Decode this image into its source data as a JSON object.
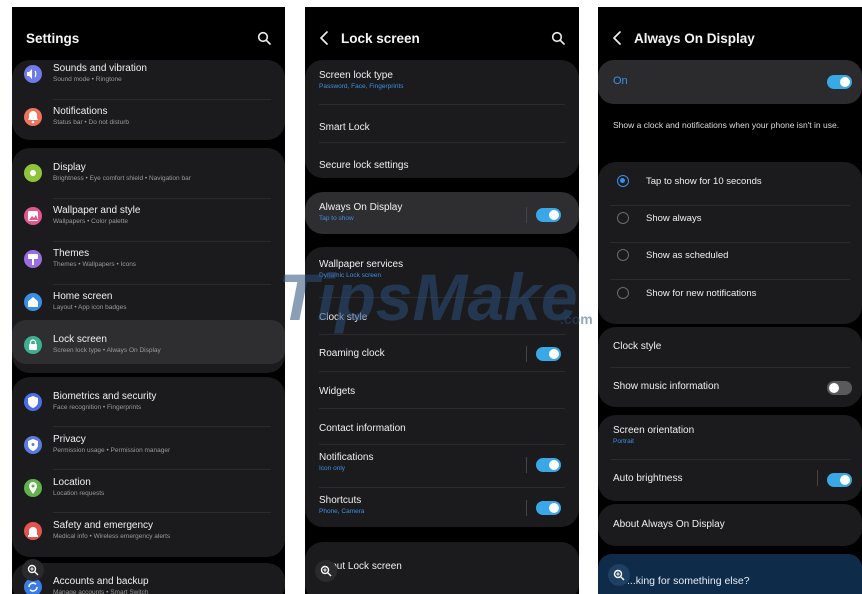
{
  "settings": {
    "title": "Settings",
    "items": [
      {
        "title": "Sounds and vibration",
        "sub": "Sound mode  •  Ringtone",
        "icon": "speaker-icon",
        "color": "#6f7be8"
      },
      {
        "title": "Notifications",
        "sub": "Status bar  •  Do not disturb",
        "icon": "bell-icon",
        "color": "#f0735a"
      },
      {
        "title": "Display",
        "sub": "Brightness  •  Eye comfort shield  •  Navigation bar",
        "icon": "sun-icon",
        "color": "#8fc43a"
      },
      {
        "title": "Wallpaper and style",
        "sub": "Wallpapers  •  Color palette",
        "icon": "image-icon",
        "color": "#e4568f"
      },
      {
        "title": "Themes",
        "sub": "Themes  •  Wallpapers  •  Icons",
        "icon": "brush-icon",
        "color": "#9a6ee0"
      },
      {
        "title": "Home screen",
        "sub": "Layout  •  App icon badges",
        "icon": "home-icon",
        "color": "#3a8ee6"
      },
      {
        "title": "Lock screen",
        "sub": "Screen lock type  •  Always On Display",
        "icon": "lock-icon",
        "color": "#3ab090"
      },
      {
        "title": "Biometrics and security",
        "sub": "Face recognition  •  Fingerprints",
        "icon": "shield-icon",
        "color": "#4a6ee6"
      },
      {
        "title": "Privacy",
        "sub": "Permission usage  •  Permission manager",
        "icon": "privacy-shield-icon",
        "color": "#5a7be0"
      },
      {
        "title": "Location",
        "sub": "Location requests",
        "icon": "location-pin-icon",
        "color": "#5fb34a"
      },
      {
        "title": "Safety and emergency",
        "sub": "Medical info  •  Wireless emergency alerts",
        "icon": "siren-icon",
        "color": "#e4544f"
      },
      {
        "title": "Accounts and backup",
        "sub": "Manage accounts  •  Smart Switch",
        "icon": "sync-icon",
        "color": "#3a7be6"
      }
    ]
  },
  "lock": {
    "title": "Lock screen",
    "items": [
      {
        "title": "Screen lock type",
        "sub": "Password, Face, Fingerprints"
      },
      {
        "title": "Smart Lock",
        "sub": ""
      },
      {
        "title": "Secure lock settings",
        "sub": ""
      },
      {
        "title": "Always On Display",
        "sub": "Tap to show",
        "toggle": true
      },
      {
        "title": "Wallpaper services",
        "sub": "Dynamic Lock screen"
      },
      {
        "title": "Clock style",
        "sub": ""
      },
      {
        "title": "Roaming clock",
        "sub": "",
        "toggle": true
      },
      {
        "title": "Widgets",
        "sub": ""
      },
      {
        "title": "Contact information",
        "sub": ""
      },
      {
        "title": "Notifications",
        "sub": "Icon only",
        "toggle": true
      },
      {
        "title": "Shortcuts",
        "sub": "Phone, Camera",
        "toggle": true
      },
      {
        "title": "About Lock screen",
        "sub": ""
      }
    ]
  },
  "aod": {
    "title": "Always On Display",
    "master_label": "On",
    "master_on": true,
    "description": "Show a clock and notifications when your phone isn't in use.",
    "options": [
      {
        "label": "Tap to show for 10 seconds",
        "selected": true
      },
      {
        "label": "Show always",
        "selected": false
      },
      {
        "label": "Show as scheduled",
        "selected": false
      },
      {
        "label": "Show for new notifications",
        "selected": false
      }
    ],
    "clock_style": "Clock style",
    "music_info": "Show music information",
    "music_info_on": false,
    "orientation_title": "Screen orientation",
    "orientation_value": "Portrait",
    "auto_brightness": "Auto brightness",
    "auto_brightness_on": true,
    "about": "About Always On Display",
    "suggest": "...king for something else?"
  },
  "watermark": {
    "brand": "TipsMake",
    "suffix": ".com"
  },
  "colors": {
    "accent": "#3aa7e6",
    "link": "#3d8fe6",
    "card": "#1b1b1d",
    "highlight": "#2e2e31"
  }
}
